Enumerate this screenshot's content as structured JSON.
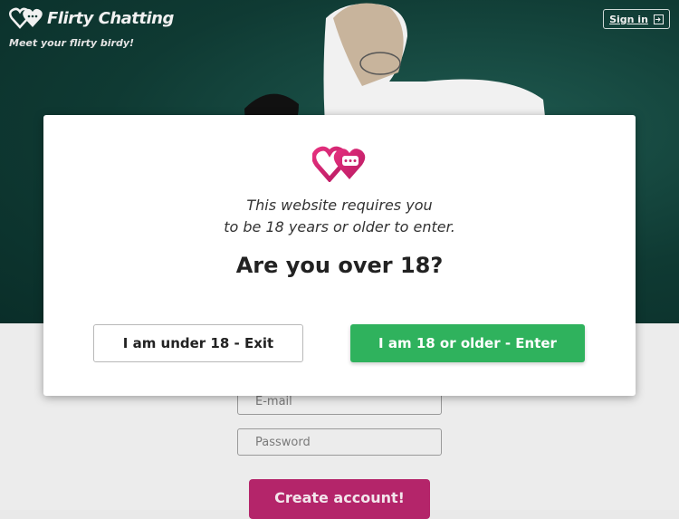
{
  "header": {
    "brand_name": "Flirty Chatting",
    "tagline": "Meet your flirty birdy!",
    "signin_label": "Sign in",
    "logo_icon": "hearts-chat-logo-icon",
    "signin_icon": "sign-in-arrow-icon"
  },
  "form": {
    "email_placeholder": "E-mail",
    "password_placeholder": "Password",
    "create_label": "Create account!"
  },
  "modal": {
    "logo_icon": "hearts-chat-logo-icon",
    "message_line1": "This website requires you",
    "message_line2": "to be 18 years or older to enter.",
    "question": "Are you over 18?",
    "exit_label": "I am under 18 - Exit",
    "enter_label": "I am 18 or older - Enter"
  },
  "colors": {
    "brand_pink": "#c8266e",
    "enter_green": "#2fb25d",
    "create_button": "#b4256a",
    "hero_teal": "#0f3a33"
  }
}
